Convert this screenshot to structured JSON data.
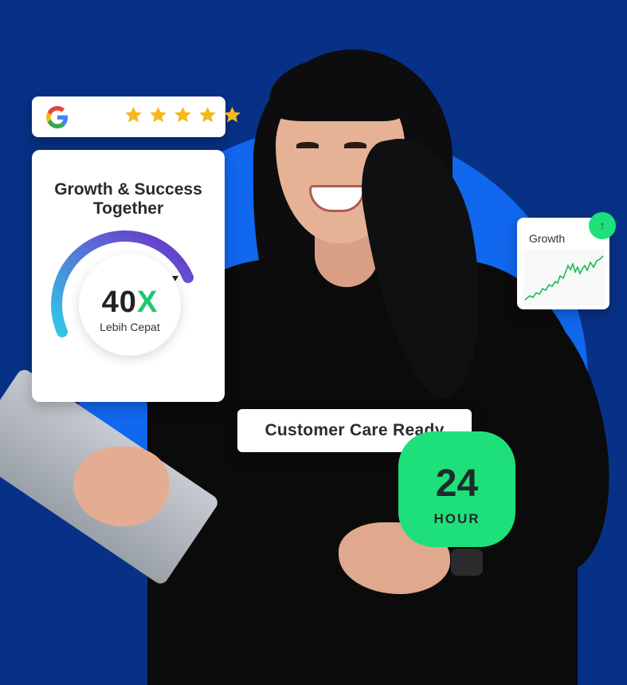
{
  "colors": {
    "background": "#073186",
    "circle": "#1167ee",
    "accent_green": "#1ee07a",
    "gauge_start": "#2ec9e3",
    "gauge_end": "#6a2fc6"
  },
  "rating": {
    "icon": "google-icon",
    "stars": 5
  },
  "growth_card": {
    "title": "Growth & Success\nTogether",
    "value_number": "40",
    "value_suffix": "X",
    "label": "Lebih Cepat"
  },
  "mini_card": {
    "label": "Growth",
    "badge_icon": "up-arrow-icon",
    "badge_symbol": "↑"
  },
  "care": {
    "text": "Customer Care Ready"
  },
  "hour_badge": {
    "number": "24",
    "unit": "HOUR"
  }
}
